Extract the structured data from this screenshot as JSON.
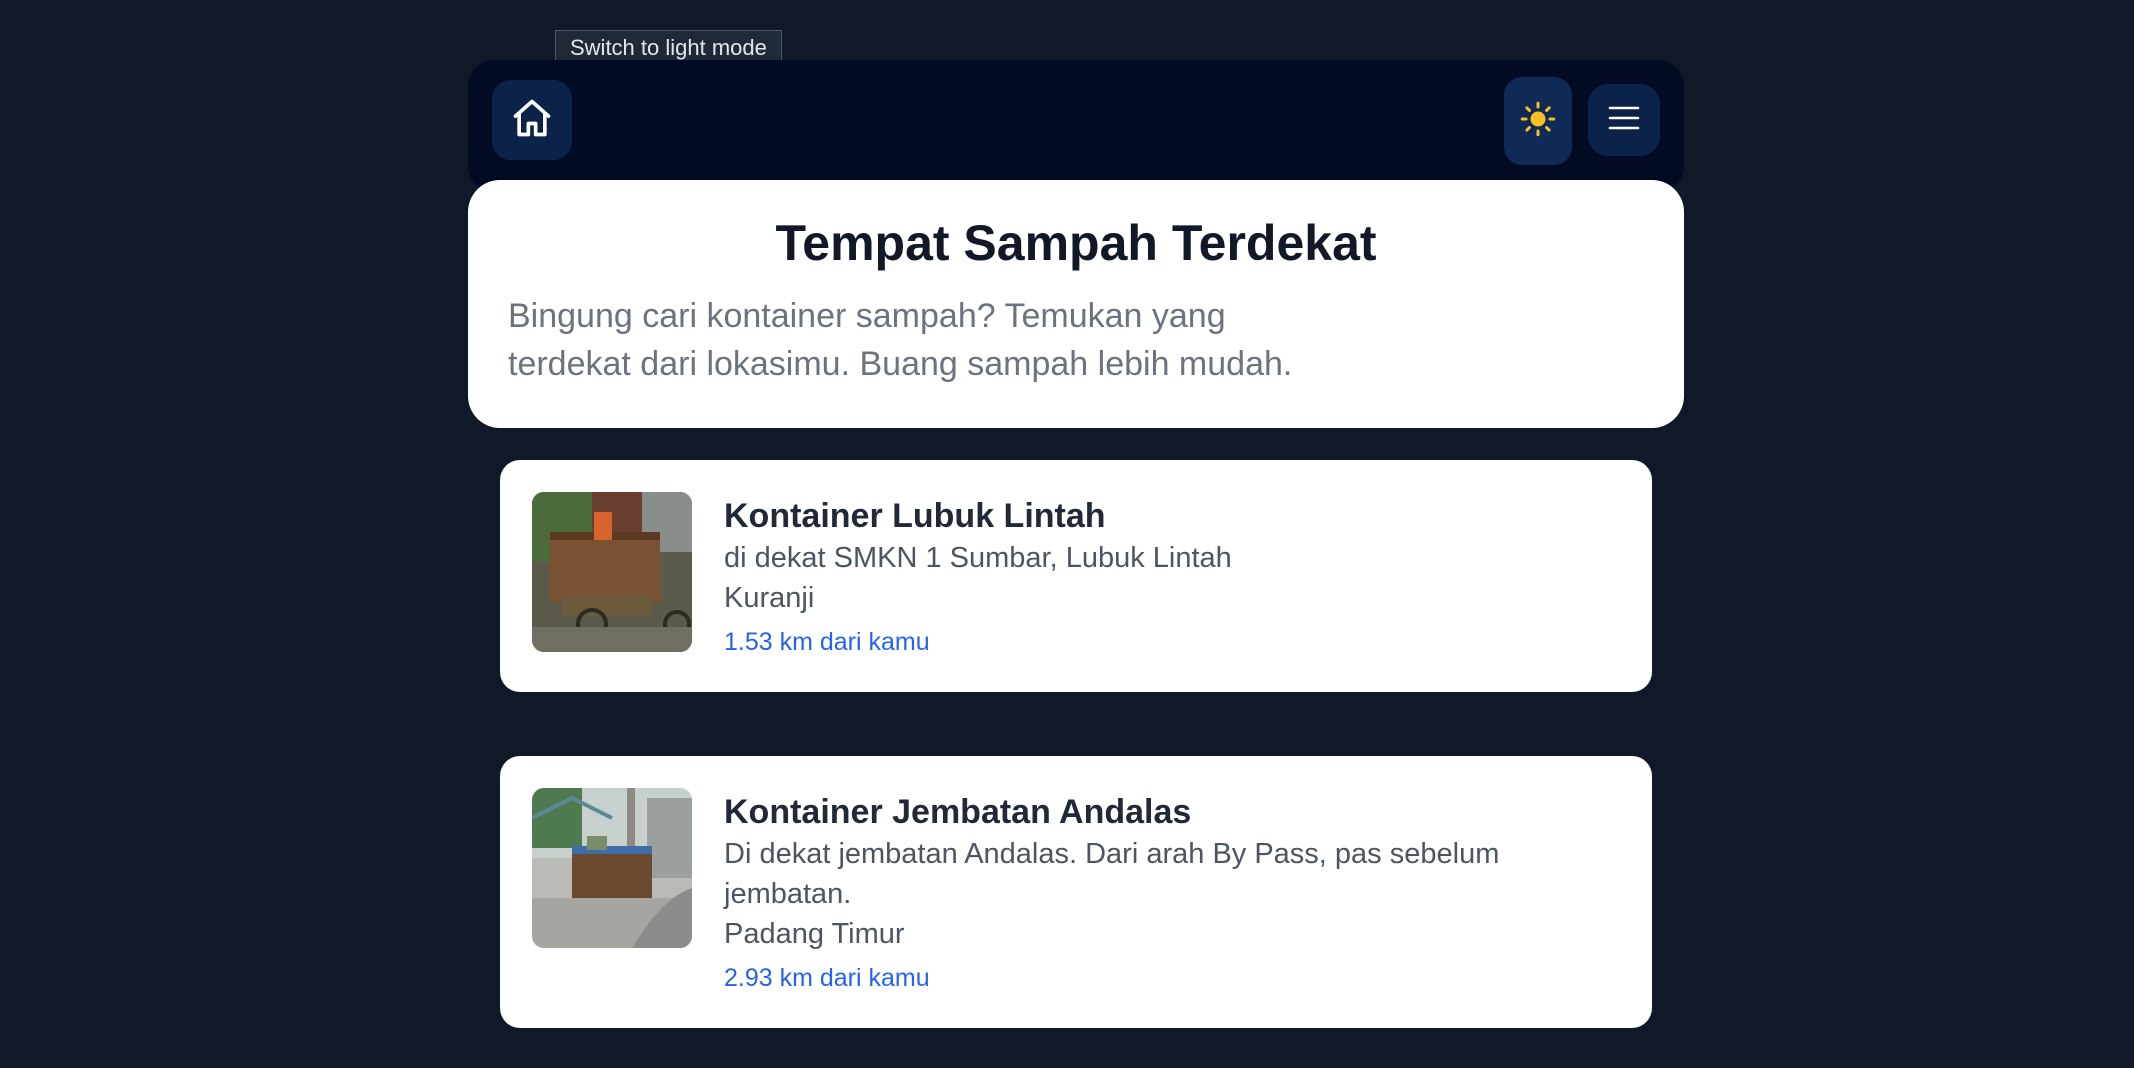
{
  "tooltip": {
    "text": "Switch to light mode"
  },
  "navbar": {
    "home_icon": "home-icon",
    "theme_icon": "sun-icon",
    "theme_glyph": "☀️",
    "menu_icon": "hamburger-menu-icon"
  },
  "hero": {
    "title": "Tempat Sampah Terdekat",
    "subtitle_line1": "Bingung cari kontainer sampah? Temukan yang",
    "subtitle_line2": "terdekat dari lokasimu. Buang sampah lebih mudah."
  },
  "containers": [
    {
      "name": "Kontainer Lubuk Lintah",
      "description": "di dekat SMKN 1 Sumbar, Lubuk Lintah",
      "area": "Kuranji",
      "distance": "1.53 km dari kamu"
    },
    {
      "name": "Kontainer Jembatan Andalas",
      "description": "Di dekat jembatan Andalas. Dari arah By Pass, pas sebelum jembatan.",
      "area": "Padang Timur",
      "distance": "2.93 km dari kamu"
    }
  ],
  "colors": {
    "background": "#111827",
    "navbar": "#030b24",
    "button": "#0b2348",
    "link": "#2563eb"
  }
}
